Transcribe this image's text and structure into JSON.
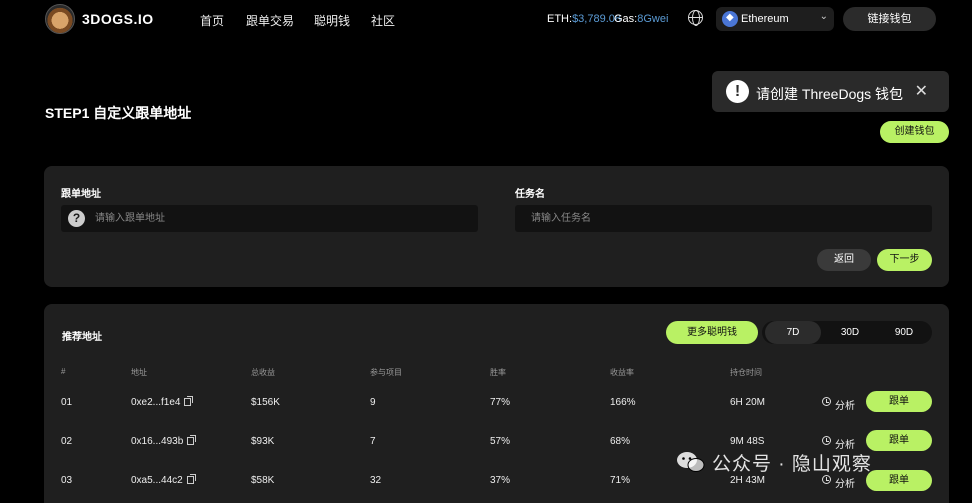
{
  "header": {
    "brand": "3DOGS.IO",
    "nav": [
      "首页",
      "跟单交易",
      "聪明钱",
      "社区"
    ],
    "eth_label": "ETH:",
    "eth_value": "$3,789.08",
    "gas_label": "Gas:",
    "gas_value": "8Gwei",
    "network": "Ethereum",
    "connect_label": "链接钱包"
  },
  "toast": {
    "text": "请创建 ThreeDogs 钱包",
    "close": "✕",
    "create_label": "创建钱包"
  },
  "step": {
    "title": "STEP1 自定义跟单地址"
  },
  "form": {
    "address_label": "跟单地址",
    "address_placeholder": "请输入跟单地址",
    "task_label": "任务名",
    "task_placeholder": "请输入任务名",
    "back_label": "返回",
    "next_label": "下一步"
  },
  "recommend": {
    "title": "推荐地址",
    "more_label": "更多聪明钱",
    "ranges": [
      "7D",
      "30D",
      "90D"
    ],
    "active_range": "7D",
    "columns": [
      "#",
      "地址",
      "总收益",
      "参与项目",
      "胜率",
      "收益率",
      "持仓时间"
    ],
    "analyze_label": "分析",
    "follow_label": "跟单",
    "rows": [
      {
        "idx": "01",
        "address": "0xe2...f1e4",
        "profit": "$156K",
        "projects": "9",
        "win_rate": "77%",
        "roi": "166%",
        "hold": "6H 20M"
      },
      {
        "idx": "02",
        "address": "0x16...493b",
        "profit": "$93K",
        "projects": "7",
        "win_rate": "57%",
        "roi": "68%",
        "hold": "9M 48S"
      },
      {
        "idx": "03",
        "address": "0xa5...44c2",
        "profit": "$58K",
        "projects": "32",
        "win_rate": "37%",
        "roi": "71%",
        "hold": "2H 43M"
      }
    ]
  },
  "watermark": {
    "text": "公众号 · 隐山观察"
  },
  "colors": {
    "accent": "#b9f164",
    "background": "#000000",
    "card": "#1f1f1f",
    "price_blue": "#5b9bd5"
  }
}
